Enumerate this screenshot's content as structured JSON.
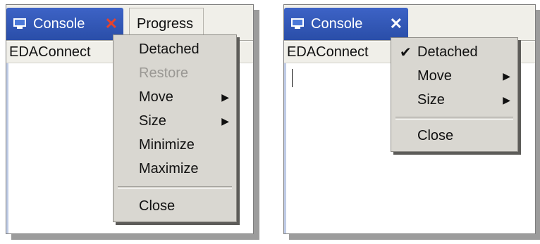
{
  "left_panel": {
    "tabs": [
      {
        "label": "Console",
        "icon": "monitor-icon",
        "close_icon": "close-icon",
        "close_color": "#e8432c"
      },
      {
        "label": "Progress"
      }
    ],
    "title": "EDAConnect",
    "menu": {
      "items": [
        {
          "label": "Detached",
          "enabled": true
        },
        {
          "label": "Restore",
          "enabled": false
        },
        {
          "label": "Move",
          "submenu": true
        },
        {
          "label": "Size",
          "submenu": true
        },
        {
          "label": "Minimize",
          "enabled": true
        },
        {
          "label": "Maximize",
          "enabled": true
        },
        {
          "label": "Close",
          "enabled": true
        }
      ]
    }
  },
  "right_panel": {
    "tabs": [
      {
        "label": "Console",
        "icon": "monitor-icon",
        "close_icon": "close-icon",
        "close_color": "#ffffff"
      }
    ],
    "title": "EDAConnect",
    "menu": {
      "items": [
        {
          "label": "Detached",
          "checked": true
        },
        {
          "label": "Move",
          "submenu": true
        },
        {
          "label": "Size",
          "submenu": true
        },
        {
          "label": "Close"
        }
      ]
    }
  },
  "glyphs": {
    "close": "✕",
    "arrow": "▶",
    "check": "✔"
  },
  "colors": {
    "tab_active": "#2a4ea8",
    "menu_bg": "#d9d7d1",
    "panel_bg": "#f0efe9"
  }
}
